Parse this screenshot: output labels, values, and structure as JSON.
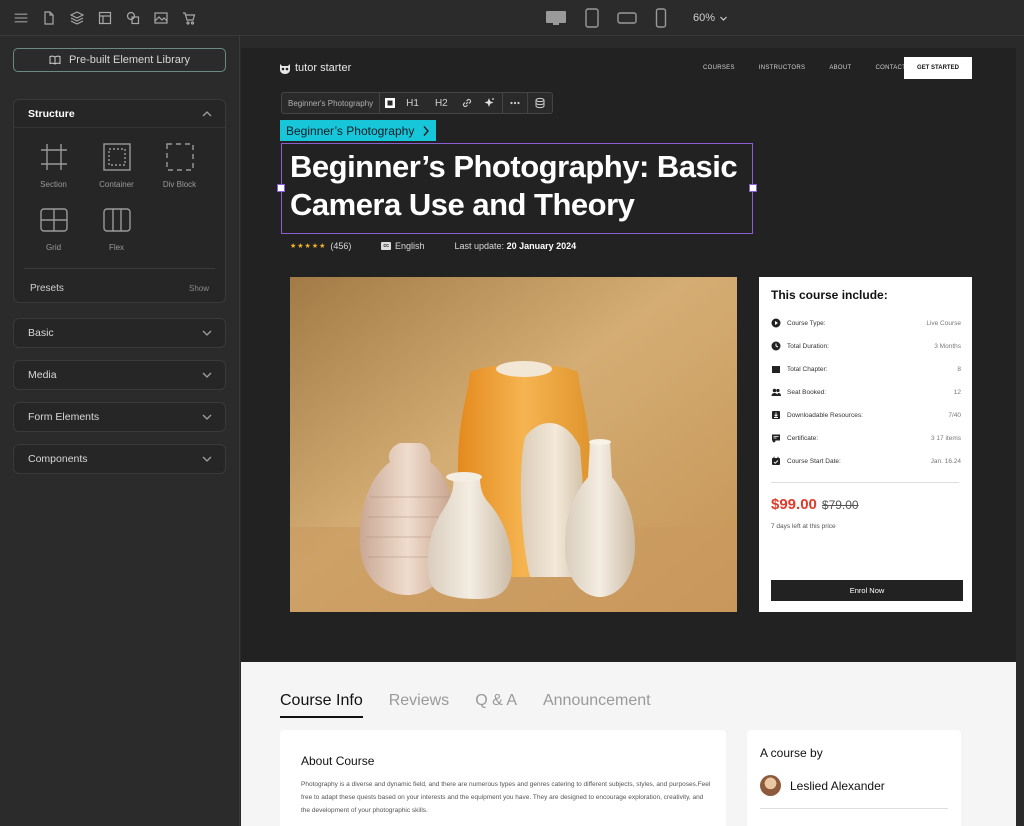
{
  "topbar": {
    "zoom": "60%",
    "icons": [
      "menu-icon",
      "page-icon",
      "layers-icon",
      "template-icon",
      "shapes-icon",
      "image-icon",
      "cart-icon"
    ],
    "devices": [
      "desktop-icon",
      "tablet-icon",
      "tablet-landscape-icon",
      "mobile-icon"
    ]
  },
  "sidebar": {
    "library_label": "Pre-built Element Library",
    "structure": {
      "title": "Structure",
      "elements": [
        {
          "label": "Section",
          "icon": "section-icon"
        },
        {
          "label": "Container",
          "icon": "container-icon"
        },
        {
          "label": "Div Block",
          "icon": "div-block-icon"
        },
        {
          "label": "Grid",
          "icon": "grid-icon"
        },
        {
          "label": "Flex",
          "icon": "flex-icon"
        }
      ],
      "presets_label": "Presets",
      "presets_show": "Show"
    },
    "panels": [
      {
        "title": "Basic"
      },
      {
        "title": "Media"
      },
      {
        "title": "Form Elements"
      },
      {
        "title": "Components"
      }
    ]
  },
  "page": {
    "logo": "tutor starter",
    "nav": [
      "COURSES",
      "INSTRUCTORS",
      "ABOUT",
      "CONTACT"
    ],
    "cta": "GET STARTED",
    "toolbar": {
      "breadcrumb": "Beginner's Photography",
      "h1": "H1",
      "h2": "H2"
    },
    "selection_tag": "Beginner’s Photography",
    "title": "Beginner’s Photography: Basic Camera Use and Theory",
    "rating_count": "(456)",
    "cc_badge": "cc",
    "language": "English",
    "last_update_label": "Last update:",
    "last_update_value": "20 January 2024",
    "card": {
      "title": "This course include:",
      "rows": [
        {
          "label": "Course Type:",
          "value": "Live Course",
          "icon": "play-circle-icon"
        },
        {
          "label": "Total Duration:",
          "value": "3 Months",
          "icon": "clock-icon"
        },
        {
          "label": "Total Chapter:",
          "value": "8",
          "icon": "book-icon"
        },
        {
          "label": "Seat Booked:",
          "value": "12",
          "icon": "users-icon"
        },
        {
          "label": "Downloadable Resources:",
          "value": "7/40",
          "icon": "download-icon"
        },
        {
          "label": "Certificate:",
          "value": "3 17 items",
          "icon": "certificate-icon"
        },
        {
          "label": "Course Start Date:",
          "value": "Jan. 16.24",
          "icon": "calendar-icon"
        }
      ],
      "price": "$99.00",
      "old_price": "$79.00",
      "days_left": "7 days left at this price",
      "enrol": "Enrol Now"
    },
    "tabs": [
      "Course Info",
      "Reviews",
      "Q & A",
      "Announcement"
    ],
    "about_title": "About Course",
    "about_text": "Photography is a diverse and dynamic field, and there are numerous types and genres catering to different subjects, styles, and purposes.Feel free to adapt these quests based on your interests and the equipment you have. They are designed to encourage exploration, creativity, and the development of your photographic skills.",
    "by_title": "A course by",
    "author": "Leslied Alexander"
  }
}
